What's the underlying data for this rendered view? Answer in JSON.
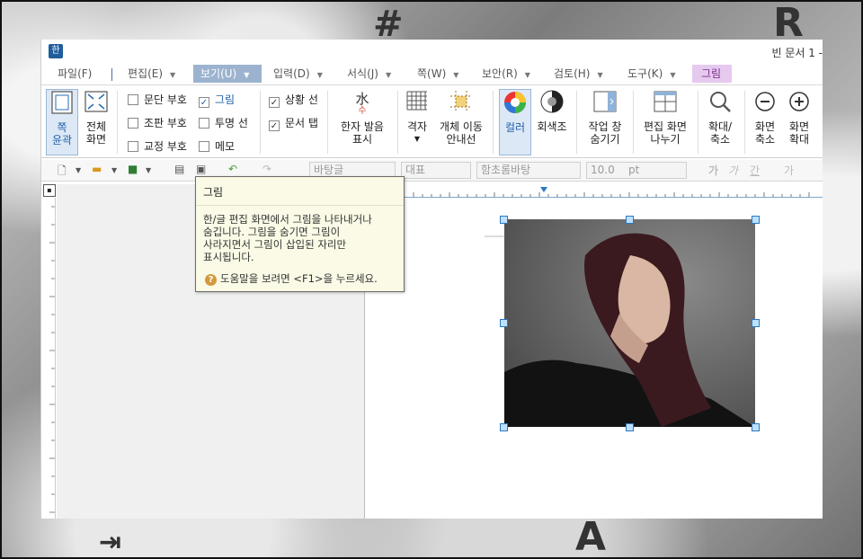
{
  "window": {
    "title": "빈 문서 1 -"
  },
  "menubar": {
    "items": [
      {
        "label": "파일(F)"
      },
      {
        "label": "편집(E)"
      },
      {
        "label": "보기(U)"
      },
      {
        "label": "입력(D)"
      },
      {
        "label": "서식(J)"
      },
      {
        "label": "쪽(W)"
      },
      {
        "label": "보안(R)"
      },
      {
        "label": "검토(H)"
      },
      {
        "label": "도구(K)"
      },
      {
        "label": "그림"
      }
    ]
  },
  "ribbon": {
    "page_outline": "쪽\n윤곽",
    "full_screen": "전체\n화면",
    "checks": {
      "para_mark": "문단 부호",
      "picture": "그림",
      "layout_mark": "조판 부호",
      "transparent_line": "투명 선",
      "proof_mark": "교정 부호",
      "memo": "메모",
      "status_line": "상황 선",
      "doc_tab": "문서 탭"
    },
    "hanja": "한자 발음\n표시",
    "grid": "격자",
    "obj_guide": "개체 이동\n안내선",
    "color": "컬러",
    "grayscale": "회색조",
    "hide_task": "작업 창\n숨기기",
    "split_view": "편집 화면\n나누기",
    "zoom": "확대/\n축소",
    "zoom_out": "화면\n축소",
    "zoom_in": "화면\n확대"
  },
  "toolbar": {
    "style": "바탕글",
    "lang": "대표",
    "font": "함초롬바탕",
    "size": "10.0",
    "unit": "pt",
    "fmt": [
      "가",
      "가",
      "간",
      "가"
    ]
  },
  "tooltip": {
    "title": "그림",
    "body": "한/글 편집 화면에서 그림을 나타내거나\n숨깁니다. 그림을 숨기면 그림이\n사라지면서 그림이 삽입된 자리만\n표시됩니다.",
    "help": "도움말을 보려면 <F1>을 누르세요."
  }
}
